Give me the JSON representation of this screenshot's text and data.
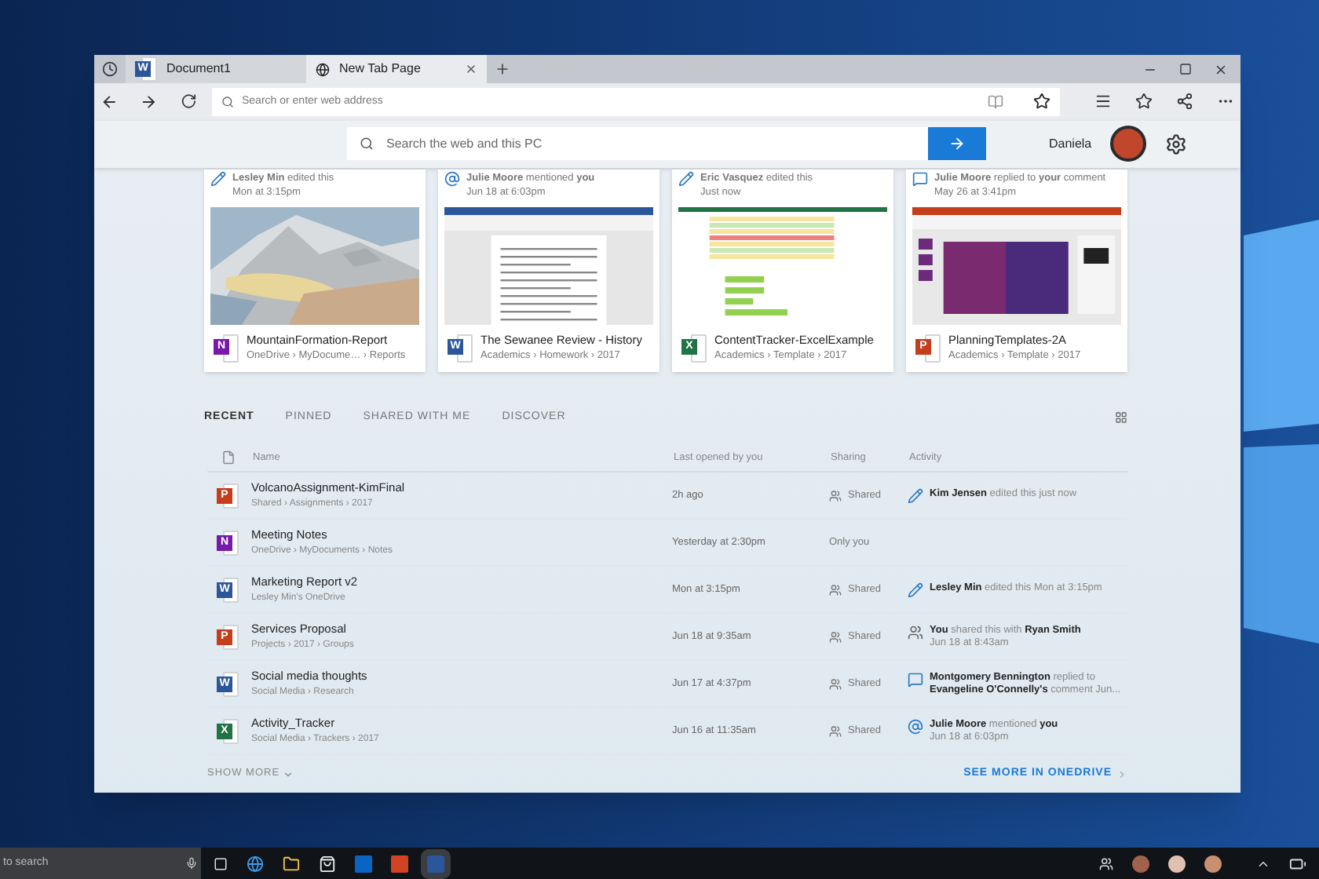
{
  "tabs": [
    {
      "title": "Document1",
      "app": {
        "letter": "W",
        "color": "#2b579a"
      },
      "selected": false
    },
    {
      "title": "New Tab Page",
      "selected": true
    }
  ],
  "address_bar": {
    "placeholder": "Search or enter web address"
  },
  "search": {
    "placeholder": "Search the web and this PC"
  },
  "user": {
    "name": "Daniela"
  },
  "cards": [
    {
      "activity": {
        "kind": "edit",
        "text": "**Lesley Min** edited this"
      },
      "time": "Mon at 3:15pm",
      "title": "MountainFormation-Report",
      "path": "OneDrive › MyDocume… › Reports",
      "app": {
        "letter": "N",
        "color": "#7719aa"
      }
    },
    {
      "activity": {
        "kind": "mention",
        "text": "**Julie Moore** mentioned **you**"
      },
      "time": "Jun 18 at 6:03pm",
      "preview": {
        "kind": "document"
      },
      "title": "The Sewanee Review - History",
      "path": "Academics › Homework › 2017",
      "app": {
        "letter": "W",
        "color": "#2b579a"
      }
    },
    {
      "activity": {
        "kind": "edit",
        "text": "**Eric Vasquez** edited this"
      },
      "time": "Just now",
      "preview": {
        "kind": "spreadsheet"
      },
      "title": "ContentTracker-ExcelExample",
      "path": "Academics › Template › 2017",
      "app": {
        "letter": "X",
        "color": "#217346"
      }
    },
    {
      "activity": {
        "kind": "comment",
        "text": "**Julie Moore** replied to **your** comment"
      },
      "time": "May 26 at 3:41pm",
      "preview": {
        "kind": "slides"
      },
      "title": "PlanningTemplates-2A",
      "path": "Academics › Template › 2017",
      "app": {
        "letter": "P",
        "color": "#c43e1c"
      }
    }
  ],
  "section_tabs": [
    {
      "label": "RECENT",
      "selected": true
    },
    {
      "label": "PINNED",
      "selected": false
    },
    {
      "label": "SHARED WITH ME",
      "selected": false
    },
    {
      "label": "DISCOVER",
      "selected": false
    }
  ],
  "table": {
    "columns": [
      "Name",
      "Last opened by you",
      "Sharing",
      "Activity"
    ],
    "rows": [
      {
        "name": "VolcanoAssignment-KimFinal",
        "path": "Shared › Assignments › 2017",
        "app": {
          "letter": "P",
          "color": "#c43e1c"
        },
        "opened": "2h ago",
        "shared": true,
        "sharing": "Shared",
        "activity": {
          "kind": "edit",
          "text": "**Kim Jensen** edited this just now"
        }
      },
      {
        "name": "Meeting Notes",
        "path": "OneDrive › MyDocuments › Notes",
        "app": {
          "letter": "N",
          "color": "#7719aa"
        },
        "opened": "Yesterday at 2:30pm",
        "shared": false,
        "sharing": "Only you"
      },
      {
        "name": "Marketing Report v2",
        "path": "Lesley Min's OneDrive",
        "app": {
          "letter": "W",
          "color": "#2b579a"
        },
        "opened": "Mon at 3:15pm",
        "shared": true,
        "sharing": "Shared",
        "activity": {
          "kind": "edit",
          "text": "**Lesley Min** edited this Mon at 3:15pm"
        }
      },
      {
        "name": "Services Proposal",
        "path": "Projects › 2017 › Groups",
        "app": {
          "letter": "P",
          "color": "#c43e1c"
        },
        "opened": "Jun 18 at 9:35am",
        "shared": true,
        "sharing": "Shared",
        "activity": {
          "kind": "share",
          "text": "**You** shared this with **Ryan Smith**",
          "time": "Jun 18 at 8:43am"
        }
      },
      {
        "name": "Social media thoughts",
        "path": "Social Media › Research",
        "app": {
          "letter": "W",
          "color": "#2b579a"
        },
        "opened": "Jun 17 at 4:37pm",
        "shared": true,
        "sharing": "Shared",
        "activity": {
          "kind": "comment",
          "text": "**Montgomery Bennington** replied to **Evangeline O'Connelly's** comment Jun..."
        }
      },
      {
        "name": "Activity_Tracker",
        "path": "Social Media › Trackers › 2017",
        "app": {
          "letter": "X",
          "color": "#217346"
        },
        "opened": "Jun 16 at 11:35am",
        "shared": true,
        "sharing": "Shared",
        "activity": {
          "kind": "mention",
          "text": "**Julie Moore** mentioned **you**",
          "time": "Jun 18 at 6:03pm"
        }
      }
    ]
  },
  "show_more": "SHOW MORE",
  "see_more": "SEE MORE IN ONEDRIVE",
  "taskbar": {
    "search_placeholder": "to search"
  }
}
